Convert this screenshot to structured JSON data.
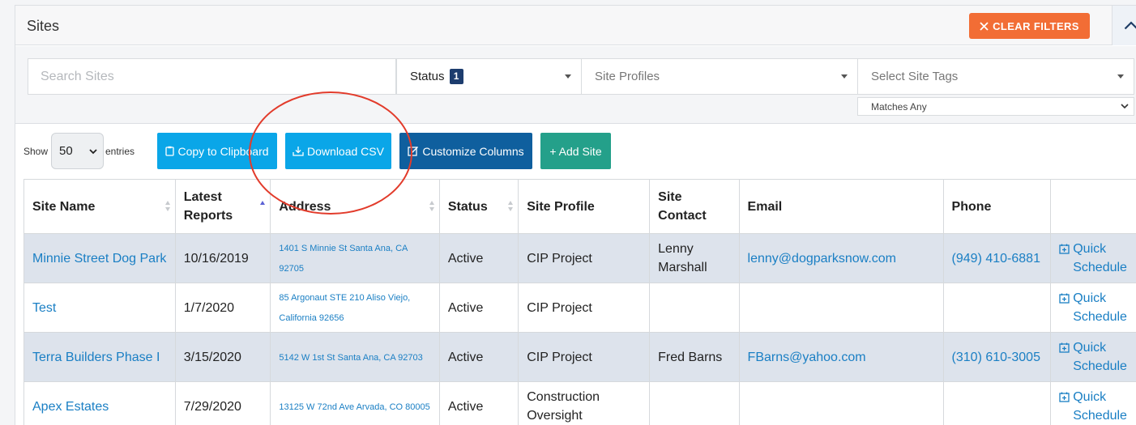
{
  "panel": {
    "title": "Sites",
    "clear_filters_label": "CLEAR FILTERS"
  },
  "filters": {
    "search_placeholder": "Search Sites",
    "status_label": "Status",
    "status_count": "1",
    "site_profiles_placeholder": "Site Profiles",
    "site_tags_placeholder": "Select Site Tags",
    "tag_match_mode": "Matches Any"
  },
  "toolbar": {
    "show_label": "Show",
    "entries_value": "50",
    "entries_label": "entries",
    "copy_label": "Copy to Clipboard",
    "csv_label": "Download CSV",
    "columns_label": "Customize Columns",
    "add_label": "+ Add Site"
  },
  "table": {
    "headers": [
      "Site Name",
      "Latest Reports",
      "Address",
      "Status",
      "Site Profile",
      "Site Contact",
      "Email",
      "Phone",
      ""
    ],
    "rows": [
      {
        "name": "Minnie Street Dog Park",
        "latest": "10/16/2019",
        "address": "1401 S Minnie St Santa Ana, CA 92705",
        "status": "Active",
        "profile": "CIP Project",
        "contact": "Lenny Marshall",
        "email": "lenny@dogparksnow.com",
        "phone": "(949) 410-6881",
        "action": "Quick Schedule"
      },
      {
        "name": "Test",
        "latest": "1/7/2020",
        "address": "85 Argonaut STE 210 Aliso Viejo, California 92656",
        "status": "Active",
        "profile": "CIP Project",
        "contact": "",
        "email": "",
        "phone": "",
        "action": "Quick Schedule"
      },
      {
        "name": "Terra Builders Phase I",
        "latest": "3/15/2020",
        "address": "5142 W 1st St Santa Ana, CA 92703",
        "status": "Active",
        "profile": "CIP Project",
        "contact": "Fred Barns",
        "email": "FBarns@yahoo.com",
        "phone": "(310) 610-3005",
        "action": "Quick Schedule"
      },
      {
        "name": "Apex Estates",
        "latest": "7/29/2020",
        "address": "13125 W 72nd Ave Arvada, CO 80005",
        "status": "Active",
        "profile": "Construction Oversight",
        "contact": "",
        "email": "",
        "phone": "",
        "action": "Quick Schedule"
      }
    ]
  },
  "colors": {
    "accent_orange": "#f26d35",
    "button_blue": "#0aa6e8",
    "button_navy": "#0f5f9e",
    "button_teal": "#24a08a",
    "link_blue": "#1a7fc4",
    "annotation_red": "#e23b2b"
  }
}
